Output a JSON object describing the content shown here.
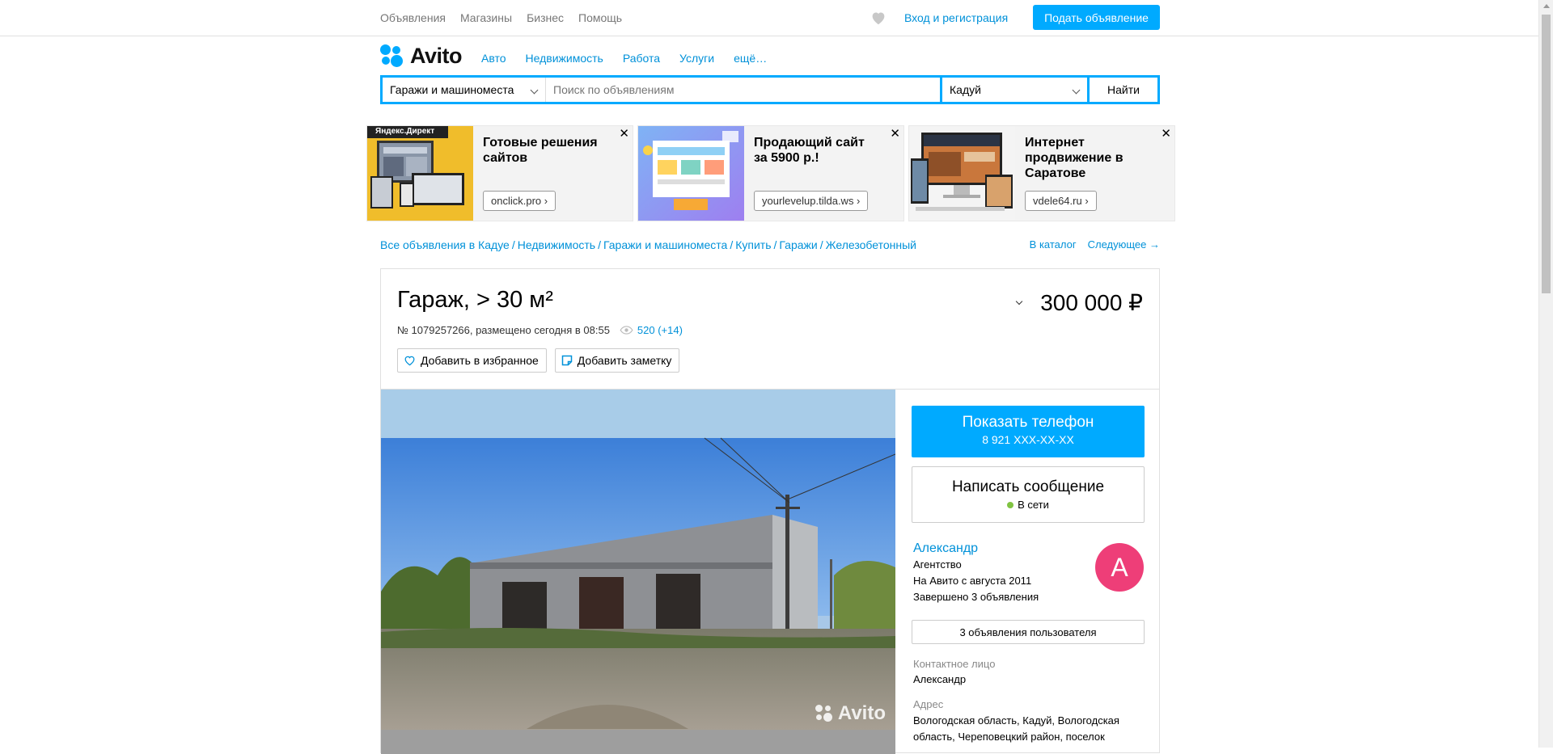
{
  "topnav": {
    "items": [
      "Объявления",
      "Магазины",
      "Бизнес",
      "Помощь"
    ],
    "login": "Вход и регистрация",
    "post_ad": "Подать объявление"
  },
  "logo": {
    "text": "Avito"
  },
  "categories": [
    "Авто",
    "Недвижимость",
    "Работа",
    "Услуги",
    "ещё…"
  ],
  "search": {
    "category": "Гаражи и машиноместа",
    "placeholder": "Поиск по объявлениям",
    "city": "Кадуй",
    "button": "Найти"
  },
  "ads": [
    {
      "badge": "Яндекс.Директ",
      "title": "Готовые решения сайтов",
      "url": "onclick.pro ›",
      "close": "✕"
    },
    {
      "title": "Продающий сайт за 5900 р.!",
      "url": "yourlevelup.tilda.ws ›",
      "close": "✕"
    },
    {
      "title": "Интернет продвижение в Саратове",
      "url": "vdele64.ru ›",
      "close": "✕"
    }
  ],
  "breadcrumbs": [
    "Все объявления в Кадуе",
    "Недвижимость",
    "Гаражи и машиноместа",
    "Купить",
    "Гаражи",
    "Железобетонный"
  ],
  "breadcrumb_separator": "/",
  "catalog": {
    "to_catalog": "В каталог",
    "next": "Следующее →"
  },
  "item": {
    "title": "Гараж, > 30 м²",
    "price": "300 000 ₽",
    "meta": "№ 1079257266, размещено сегодня в 08:55",
    "views": "520 (+14)",
    "add_favorite": "Добавить в избранное",
    "add_note": "Добавить заметку",
    "watermark": "Avito"
  },
  "contact": {
    "show_phone": "Показать телефон",
    "phone_masked": "8 921 XXX-XX-XX",
    "write_message": "Написать сообщение",
    "online": "В сети"
  },
  "seller": {
    "name": "Александр",
    "type": "Агентство",
    "since": "На Авито с августа 2011",
    "completed": "Завершено 3 объявления",
    "avatar_letter": "А",
    "user_ads": "3 объявления пользователя"
  },
  "details": {
    "contact_label": "Контактное лицо",
    "contact_value": "Александр",
    "address_label": "Адрес",
    "address_line1": "Вологодская область, Кадуй, Вологодская",
    "address_line2": "область, Череповецкий район, поселок"
  },
  "colors": {
    "accent": "#00aaff",
    "link": "#0091d9",
    "avatar": "#ee3e78",
    "online": "#80c342"
  }
}
